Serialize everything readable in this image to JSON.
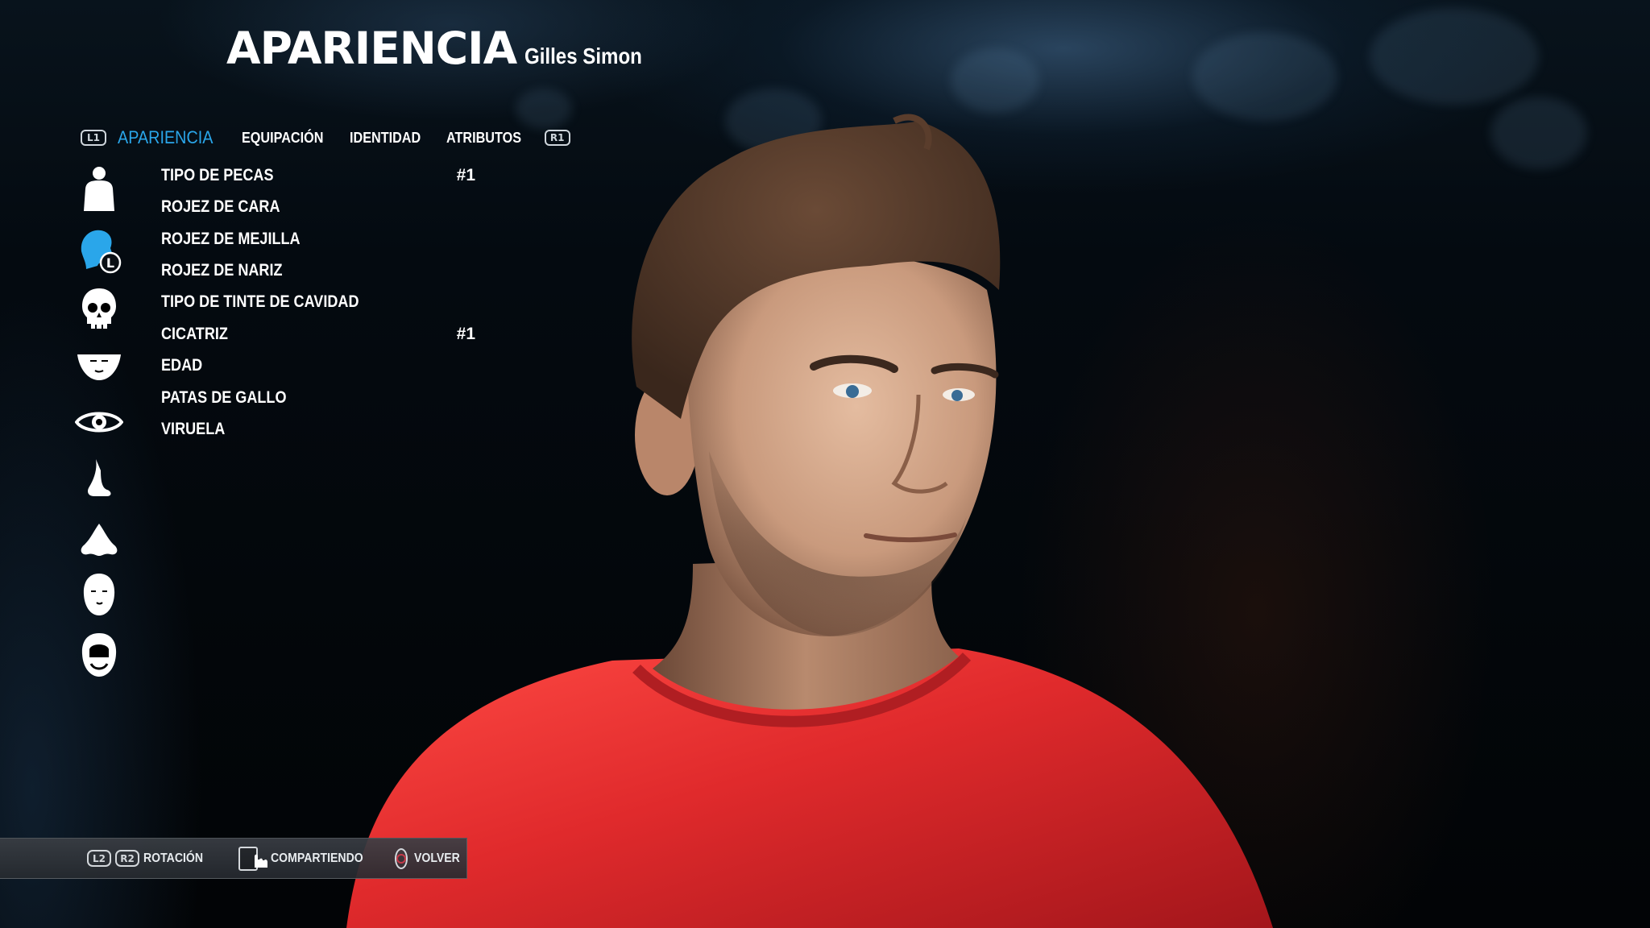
{
  "header": {
    "title": "APARIENCIA",
    "player_name": "Gilles Simon"
  },
  "tabs": {
    "left_button": "L1",
    "right_button": "R1",
    "items": [
      {
        "label": "APARIENCIA",
        "active": true
      },
      {
        "label": "EQUIPACIÓN",
        "active": false
      },
      {
        "label": "IDENTIDAD",
        "active": false
      },
      {
        "label": "ATRIBUTOS",
        "active": false
      }
    ]
  },
  "category_icons": [
    {
      "name": "body-icon",
      "selected": false
    },
    {
      "name": "head-profile-icon",
      "selected": true,
      "badge": "L"
    },
    {
      "name": "skull-icon",
      "selected": false
    },
    {
      "name": "face-lower-icon",
      "selected": false
    },
    {
      "name": "eye-icon",
      "selected": false
    },
    {
      "name": "nose-icon",
      "selected": false
    },
    {
      "name": "nose-front-icon",
      "selected": false
    },
    {
      "name": "bald-head-icon",
      "selected": false
    },
    {
      "name": "hair-beard-icon",
      "selected": false
    }
  ],
  "menu": {
    "items": [
      {
        "label": "TIPO DE PECAS",
        "value": "#1"
      },
      {
        "label": "ROJEZ DE CARA",
        "value": ""
      },
      {
        "label": "ROJEZ DE MEJILLA",
        "value": ""
      },
      {
        "label": "ROJEZ DE NARIZ",
        "value": ""
      },
      {
        "label": "TIPO DE TINTE DE CAVIDAD",
        "value": ""
      },
      {
        "label": "CICATRIZ",
        "value": "#1"
      },
      {
        "label": "EDAD",
        "value": ""
      },
      {
        "label": "PATAS DE GALLO",
        "value": ""
      },
      {
        "label": "VIRUELA",
        "value": ""
      }
    ]
  },
  "hints": {
    "rotate_buttons": [
      "L2",
      "R2"
    ],
    "rotate_label": "ROTACIÓN",
    "share_label": "COMPARTIENDO",
    "back_label": "VOLVER"
  },
  "colors": {
    "accent": "#2aa6ea",
    "shirt": "#d9282c",
    "hair": "#4a3326",
    "skin": "#c99a7d"
  }
}
